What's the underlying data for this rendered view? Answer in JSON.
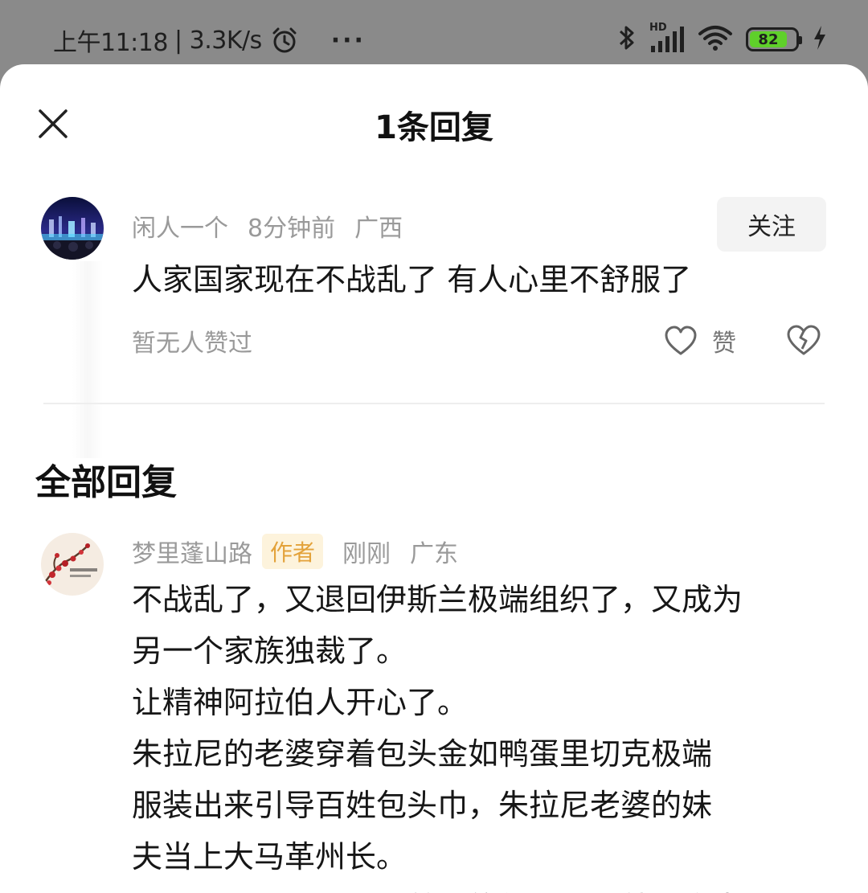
{
  "status_bar": {
    "time": "上午11:18",
    "speed": "| 3.3K/s",
    "battery": "82",
    "signal_label": "HD",
    "dots": "···"
  },
  "sheet": {
    "title": "1条回复"
  },
  "parent_comment": {
    "username": "闲人一个",
    "time": "8分钟前",
    "location": "广西",
    "follow_label": "关注",
    "text": "人家国家现在不战乱了 有人心里不舒服了",
    "likes_status": "暂无人赞过",
    "like_label": "赞"
  },
  "replies_section": {
    "title": "全部回复"
  },
  "reply": {
    "username": "梦里蓬山路",
    "badge": "作者",
    "time": "刚刚",
    "location": "广东",
    "lines": [
      "不战乱了，又退回伊斯兰极端组织了，又成为",
      "另一个家族独裁了。",
      "让精神阿拉伯人开心了。",
      "朱拉尼的老婆穿着包头金如鸭蛋里切克极端",
      "服装出来引导百姓包头巾，朱拉尼老婆的妹",
      "夫当上大马革州长。",
      "你不是深山，你不是首世的伊克，你就不会去"
    ]
  }
}
